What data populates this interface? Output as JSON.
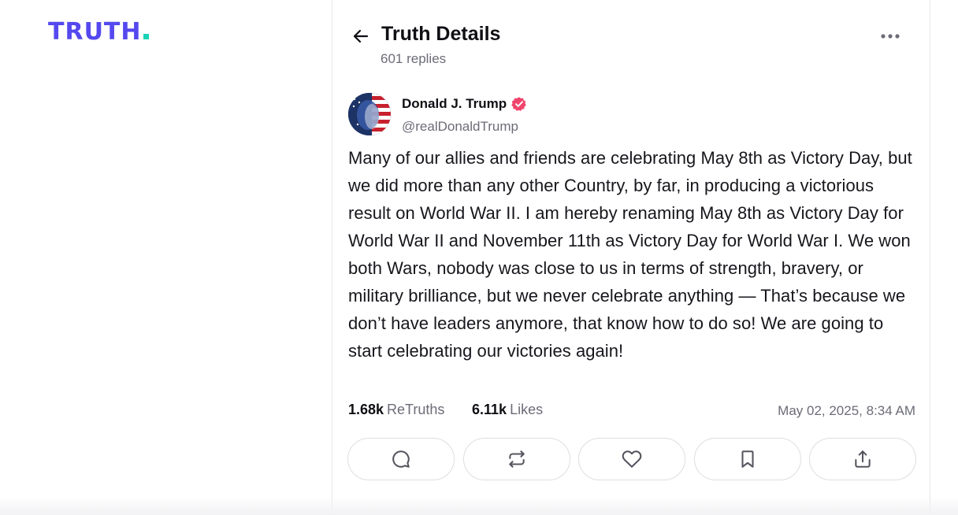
{
  "brand": {
    "logo_text": "TRUTH",
    "colors": {
      "logo": "#5448ee",
      "logo_dot": "#17d4b7",
      "verified": "#f0456b"
    }
  },
  "header": {
    "back_icon": "arrow-left-icon",
    "title": "Truth Details",
    "replies": "601 replies",
    "more_icon": "more-horizontal-icon"
  },
  "post": {
    "author_name": "Donald J. Trump",
    "author_handle": "@realDonaldTrump",
    "verified_icon": "verified-badge-icon",
    "text": "Many of our allies and friends are celebrating May 8th as Victory Day, but we did more than any other Country, by far, in producing a victorious result on World War II. I am hereby renaming May 8th as Victory Day for World War II and November 11th as Victory Day for World War I. We won both Wars, nobody was close to us in terms of strength, bravery, or military brilliance, but we never celebrate anything — That’s because we don’t have leaders  anymore, that know how to do so! We are going to start celebrating our victories again!",
    "retruths_count": "1.68k",
    "retruths_label": "ReTruths",
    "likes_count": "6.11k",
    "likes_label": "Likes",
    "timestamp": "May 02, 2025, 8:34 AM"
  },
  "actions": [
    {
      "name": "reply",
      "icon": "reply-bubble-icon"
    },
    {
      "name": "retruth",
      "icon": "retruth-icon"
    },
    {
      "name": "like",
      "icon": "heart-icon"
    },
    {
      "name": "bookmark",
      "icon": "bookmark-icon"
    },
    {
      "name": "share",
      "icon": "share-icon"
    }
  ]
}
